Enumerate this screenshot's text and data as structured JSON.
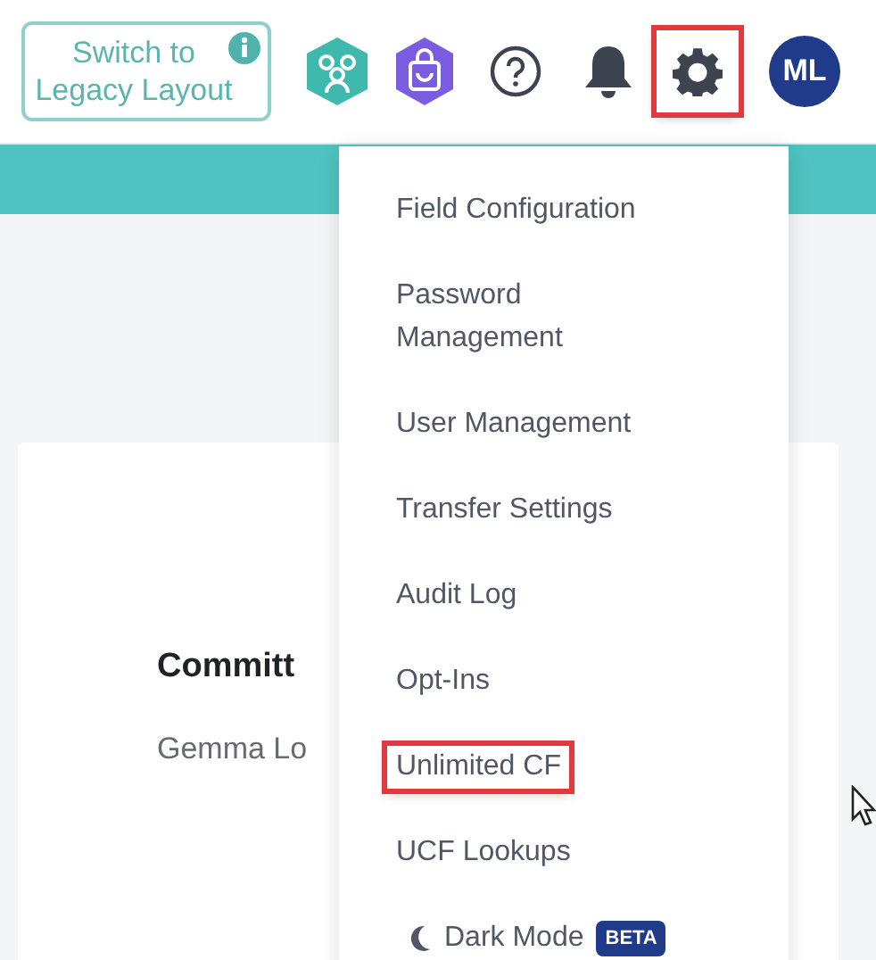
{
  "header": {
    "legacy_button": {
      "label": "Switch to Legacy Layout"
    },
    "settings_button": {
      "highlighted": true
    },
    "avatar": {
      "initials": "ML"
    }
  },
  "card": {
    "title": "Committ",
    "text": "Gemma Lo"
  },
  "settings_menu": {
    "items": [
      {
        "label": "Field Configuration",
        "highlighted": false
      },
      {
        "label": "Password Management",
        "highlighted": false
      },
      {
        "label": "User Management",
        "highlighted": false
      },
      {
        "label": "Transfer Settings",
        "highlighted": false
      },
      {
        "label": "Audit Log",
        "highlighted": false
      },
      {
        "label": "Opt-Ins",
        "highlighted": false
      },
      {
        "label": "Unlimited CF",
        "highlighted": true
      },
      {
        "label": "UCF Lookups",
        "highlighted": false
      }
    ],
    "dark_mode": {
      "label": "Dark Mode",
      "badge": "BETA"
    }
  }
}
